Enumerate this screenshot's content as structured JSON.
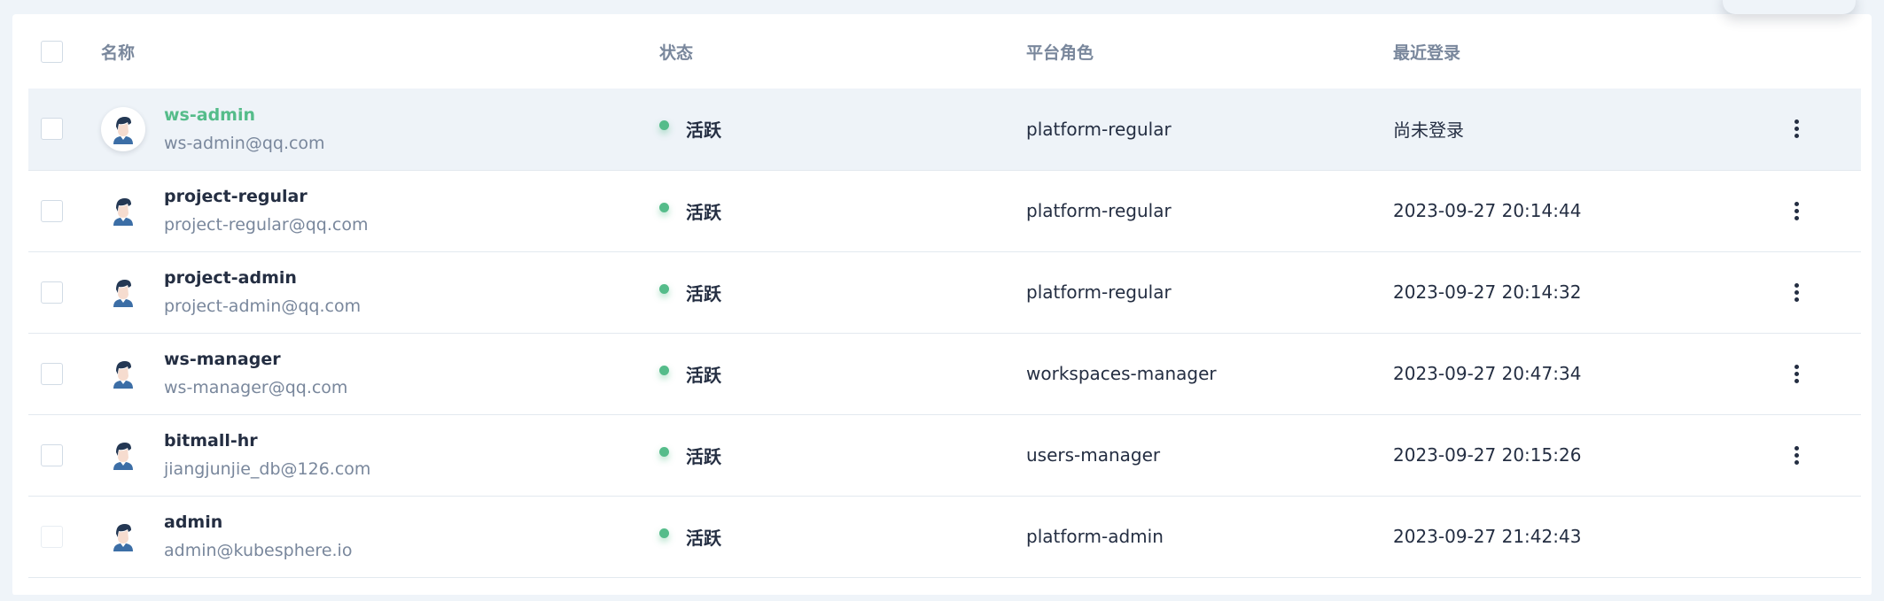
{
  "table": {
    "headers": {
      "name": "名称",
      "status": "状态",
      "role": "平台角色",
      "last_login": "最近登录"
    },
    "rows": [
      {
        "name": "ws-admin",
        "email": "ws-admin@qq.com",
        "status": "活跃",
        "role": "platform-regular",
        "last_login": "尚未登录"
      },
      {
        "name": "project-regular",
        "email": "project-regular@qq.com",
        "status": "活跃",
        "role": "platform-regular",
        "last_login": "2023-09-27 20:14:44"
      },
      {
        "name": "project-admin",
        "email": "project-admin@qq.com",
        "status": "活跃",
        "role": "platform-regular",
        "last_login": "2023-09-27 20:14:32"
      },
      {
        "name": "ws-manager",
        "email": "ws-manager@qq.com",
        "status": "活跃",
        "role": "workspaces-manager",
        "last_login": "2023-09-27 20:47:34"
      },
      {
        "name": "bitmall-hr",
        "email": "jiangjunjie_db@126.com",
        "status": "活跃",
        "role": "users-manager",
        "last_login": "2023-09-27 20:15:26"
      },
      {
        "name": "admin",
        "email": "admin@kubesphere.io",
        "status": "活跃",
        "role": "platform-admin",
        "last_login": "2023-09-27 21:42:43"
      }
    ]
  },
  "colors": {
    "accent": "#55bc8a",
    "text": "#242e42",
    "muted": "#79879c",
    "selected_row": "#eef3f8"
  },
  "icons": {
    "avatar": "user-avatar-icon",
    "status": "status-dot-icon",
    "actions": "more-vertical-icon"
  }
}
